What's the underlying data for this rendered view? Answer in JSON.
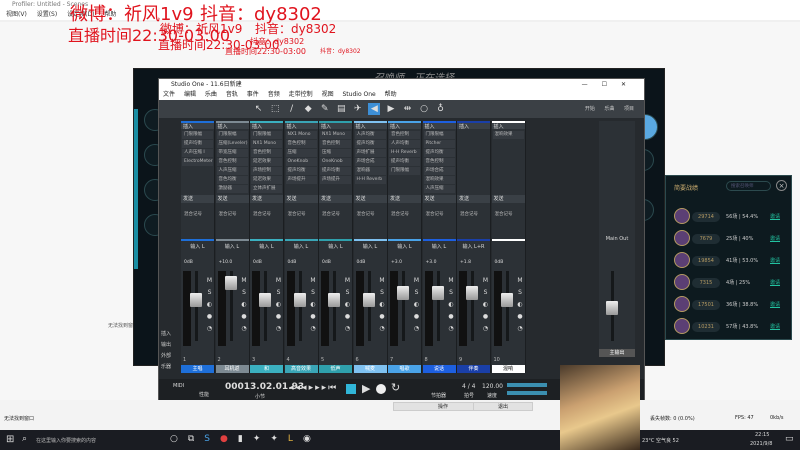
{
  "obs": {
    "title": "Profiler: Untitled - Scenes",
    "menu": [
      "视图(V)",
      "设置(S)",
      "设定帧(D)",
      "帮助"
    ],
    "status_left": "无法找到窗口",
    "status_right": {
      "dropped": "丢失帧数: 0 (0.0%)",
      "fps": "FPS: 47",
      "kbps": "0kb/s"
    },
    "btn_operate": "操作",
    "btn_exit": "退出",
    "side_label": "无法找到窗口"
  },
  "overlay": {
    "weibo": "微博：祈风1v9",
    "douyin": "抖音：dy8302",
    "live_time": "直播时间22:30-03:00"
  },
  "game": {
    "title": "召唤师，正在选择"
  },
  "studio": {
    "title": "Studio One - 11.6日新建",
    "menu": [
      "文件",
      "编辑",
      "乐曲",
      "音轨",
      "事件",
      "音频",
      "走带控制",
      "视图",
      "Studio One",
      "帮助"
    ],
    "toolbar_right": [
      "开始",
      "乐曲",
      "项目"
    ],
    "window_controls": [
      "—",
      "☐",
      "✕"
    ],
    "insert_label": "插入",
    "send_label": "发送",
    "side_labels": [
      "插入",
      "输出",
      "外部",
      "乐器"
    ],
    "channels": [
      {
        "num": "1",
        "input": "输入 L",
        "vol": "0dB",
        "name": "主唱",
        "color": "#1e6fd9",
        "slots": [
          "门限限幅",
          "提声均衡",
          "人声压缩 I",
          "ElectroMeter"
        ]
      },
      {
        "num": "2",
        "input": "输入 L",
        "vol": "+10.0",
        "name": "耳机返",
        "color": "#7d8a93",
        "slots": [
          "门限限幅",
          "压缩(Leveler)",
          "带宽压缩",
          "音色控制",
          "人声压缩",
          "音色均衡",
          "激励器"
        ]
      },
      {
        "num": "3",
        "input": "输入 L",
        "vol": "0dB",
        "name": "和",
        "color": "#3bb0c0",
        "slots": [
          "门限限幅",
          "NX1 Mono",
          "音色控制",
          "延迟效果",
          "声场控制",
          "延迟效果",
          "立体声扩展"
        ]
      },
      {
        "num": "4",
        "input": "输入 L",
        "vol": "0dB",
        "name": "高音效果",
        "color": "#3aa5b6",
        "slots": [
          "NX1 Mono",
          "音色控制",
          "压缩",
          "OneKnob",
          "提声均衡",
          "声场提升"
        ]
      },
      {
        "num": "5",
        "input": "输入 L",
        "vol": "0dB",
        "name": "低声",
        "color": "#2fa0ac",
        "slots": [
          "NX1 Mono",
          "音色控制",
          "压缩",
          "OneKnob",
          "提声均衡",
          "声场提升"
        ]
      },
      {
        "num": "6",
        "input": "输入 L",
        "vol": "0dB",
        "name": "喊麦",
        "color": "#7fc1f0",
        "slots": [
          "人声均衡",
          "提声均衡",
          "声场扩展",
          "声场合成",
          "混响器",
          "H-H Reverb"
        ]
      },
      {
        "num": "7",
        "input": "输入 L",
        "vol": "+3.0",
        "name": "唱歌",
        "color": "#4aa3e8",
        "slots": [
          "音色控制",
          "人声均衡",
          "H-H Reverb",
          "提声均衡",
          "门限限幅"
        ]
      },
      {
        "num": "8",
        "input": "输入 L",
        "vol": "+3.0",
        "name": "说话",
        "color": "#1d5fe0",
        "slots": [
          "门限限幅",
          "Pitcher",
          "提声均衡",
          "音色控制",
          "声场合成",
          "混响效果",
          "人声压缩"
        ]
      },
      {
        "num": "9",
        "input": "输入 L+R",
        "vol": "+1.8",
        "name": "伴奏",
        "color": "#1a3fa8",
        "slots": []
      },
      {
        "num": "10",
        "input": "",
        "vol": "0dB",
        "name": "混响",
        "color": "#ffffff",
        "slots": [
          "混响效果"
        ]
      }
    ],
    "output_channel": {
      "label": "Main Out",
      "name": "主输出"
    },
    "mix_label": "混合记号",
    "transport": {
      "position": "00013.02.01.93",
      "position_label": "小节",
      "midi_label": "MIDI",
      "perf_label": "性能",
      "time_sig": "4 / 4",
      "time_sig_label": "拍号",
      "tempo": "120.00",
      "tempo_label": "速度",
      "sync_label": "节拍器"
    }
  },
  "friends": {
    "title": "简要战绩",
    "search_placeholder": "搜索召唤师",
    "rows": [
      {
        "id": "29714",
        "stats": "56场 | 54.4%",
        "action": "邀请"
      },
      {
        "id": "7679",
        "stats": "25场 | 40%",
        "action": "邀请"
      },
      {
        "id": "19854",
        "stats": "41场 | 53.0%",
        "action": "邀请"
      },
      {
        "id": "7315",
        "stats": "4场 | 25%",
        "action": "邀请"
      },
      {
        "id": "17501",
        "stats": "36场 | 38.8%",
        "action": "邀请"
      },
      {
        "id": "10231",
        "stats": "57场 | 43.8%",
        "action": "邀请"
      }
    ]
  },
  "taskbar": {
    "search_placeholder": "在这里输入你要搜索的内容",
    "weather": "23°C 空气良 52",
    "time": "22:15",
    "date": "2021/9/8"
  }
}
